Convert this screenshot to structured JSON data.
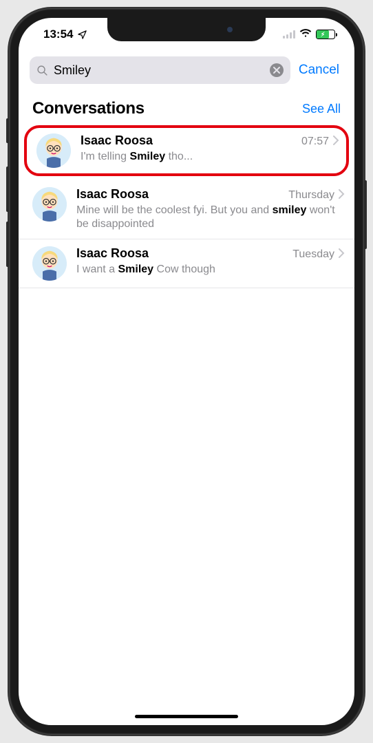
{
  "status": {
    "time": "13:54",
    "location_icon": "location-arrow",
    "battery_charging": true
  },
  "search": {
    "value": "Smiley",
    "placeholder": "Search",
    "cancel": "Cancel"
  },
  "section": {
    "title": "Conversations",
    "see_all": "See All"
  },
  "results": [
    {
      "name": "Isaac Roosa",
      "time": "07:57",
      "preview_pre": "I'm telling ",
      "preview_match": "Smiley",
      "preview_post": " tho...",
      "highlighted": true
    },
    {
      "name": "Isaac Roosa",
      "time": "Thursday",
      "preview_pre": "Mine will be the coolest fyi. But you and ",
      "preview_match": "smiley",
      "preview_post": " won't be disappointed",
      "highlighted": false
    },
    {
      "name": "Isaac Roosa",
      "time": "Tuesday",
      "preview_pre": "I want a ",
      "preview_match": "Smiley",
      "preview_post": " Cow though",
      "highlighted": false
    }
  ]
}
